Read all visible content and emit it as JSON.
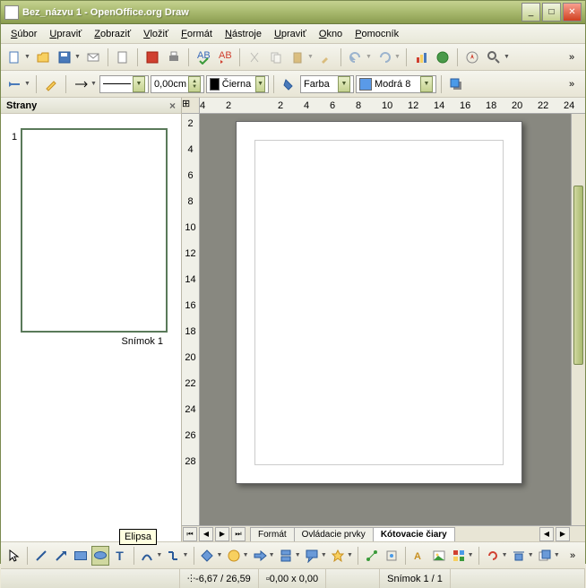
{
  "title": "Bez_názvu 1 - OpenOffice.org Draw",
  "menubar": [
    "Súbor",
    "Upraviť",
    "Zobraziť",
    "Vložiť",
    "Formát",
    "Nástroje",
    "Upraviť",
    "Okno",
    "Pomocník"
  ],
  "line_width": "0,00cm",
  "line_color_label": "Čierna",
  "fill_type": "Farba",
  "fill_color_label": "Modrá 8",
  "side_panel_title": "Strany",
  "slide_number": "1",
  "slide_label": "Snímok 1",
  "h_ruler_marks": [
    "4",
    "2",
    "",
    "2",
    "4",
    "6",
    "8",
    "10",
    "12",
    "14",
    "16",
    "18",
    "20",
    "22",
    "24"
  ],
  "v_ruler_marks": [
    "2",
    "4",
    "6",
    "8",
    "10",
    "12",
    "14",
    "16",
    "18",
    "20",
    "22",
    "24",
    "26",
    "28"
  ],
  "tabs": [
    {
      "label": "Formát",
      "active": false
    },
    {
      "label": "Ovládacie prvky",
      "active": false
    },
    {
      "label": "Kótovacie čiary",
      "active": true
    }
  ],
  "tooltip": "Elipsa",
  "status": {
    "pos": "-6,67 / 26,59",
    "size": "0,00 x 0,00",
    "slide": "Snímok 1 / 1"
  }
}
